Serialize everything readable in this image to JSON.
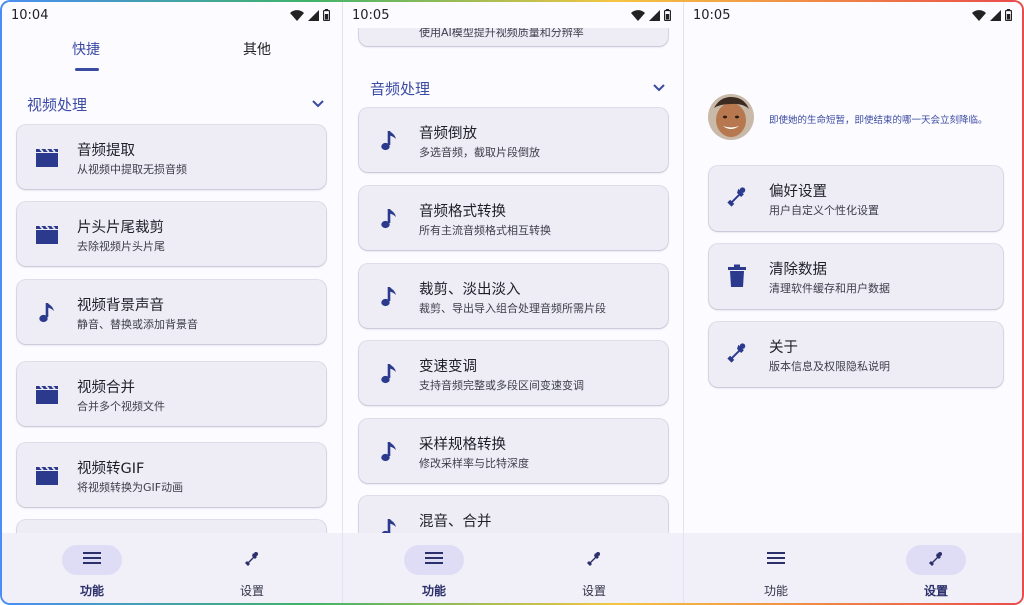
{
  "colors": {
    "accent": "#3b4ba3",
    "card_bg": "#eeedf6",
    "navbar_bg": "#f1eff7",
    "nav_active_pill": "#dfdcf6"
  },
  "screen1": {
    "time": "10:04",
    "tabs": [
      {
        "label": "快捷",
        "active": true
      },
      {
        "label": "其他",
        "active": false
      }
    ],
    "section_title": "视频处理",
    "cards": [
      {
        "icon": "clapperboard-icon",
        "title": "音频提取",
        "sub": "从视频中提取无损音频"
      },
      {
        "icon": "clapperboard-icon",
        "title": "片头片尾裁剪",
        "sub": "去除视频片头片尾"
      },
      {
        "icon": "music-note-icon",
        "title": "视频背景声音",
        "sub": "静音、替换或添加背景音"
      },
      {
        "icon": "clapperboard-icon",
        "title": "视频合并",
        "sub": "合并多个视频文件"
      },
      {
        "icon": "clapperboard-icon",
        "title": "视频转GIF",
        "sub": "将视频转换为GIF动画"
      }
    ],
    "nav": [
      {
        "icon": "list-icon",
        "label": "功能",
        "active": true
      },
      {
        "icon": "wrench-icon",
        "label": "设置",
        "active": false
      }
    ]
  },
  "screen2": {
    "time": "10:05",
    "top_partial_sub": "使用AI模型提升视频质量和分辨率",
    "section_title": "音频处理",
    "cards": [
      {
        "icon": "music-note-icon",
        "title": "音频倒放",
        "sub": "多选音频，截取片段倒放"
      },
      {
        "icon": "music-note-icon",
        "title": "音频格式转换",
        "sub": "所有主流音频格式相互转换"
      },
      {
        "icon": "music-note-icon",
        "title": "裁剪、淡出淡入",
        "sub": "裁剪、导出导入组合处理音频所需片段"
      },
      {
        "icon": "music-note-icon",
        "title": "变速变调",
        "sub": "支持音频完整或多段区间变速变调"
      },
      {
        "icon": "music-note-icon",
        "title": "采样规格转换",
        "sub": "修改采样率与比特深度"
      },
      {
        "icon": "music-note-icon",
        "title": "混音、合并",
        "sub": ""
      }
    ],
    "nav": [
      {
        "icon": "list-icon",
        "label": "功能",
        "active": true
      },
      {
        "icon": "wrench-icon",
        "label": "设置",
        "active": false
      }
    ]
  },
  "screen3": {
    "time": "10:05",
    "profile_quote": "即使她的生命短暂，即使结束的哪一天会立刻降临。",
    "cards": [
      {
        "icon": "wrench-icon",
        "title": "偏好设置",
        "sub": "用户自定义个性化设置"
      },
      {
        "icon": "trash-icon",
        "title": "清除数据",
        "sub": "清理软件缓存和用户数据"
      },
      {
        "icon": "wrench-icon",
        "title": "关于",
        "sub": "版本信息及权限隐私说明"
      }
    ],
    "nav": [
      {
        "icon": "list-icon",
        "label": "功能",
        "active": false
      },
      {
        "icon": "wrench-icon",
        "label": "设置",
        "active": true
      }
    ]
  }
}
